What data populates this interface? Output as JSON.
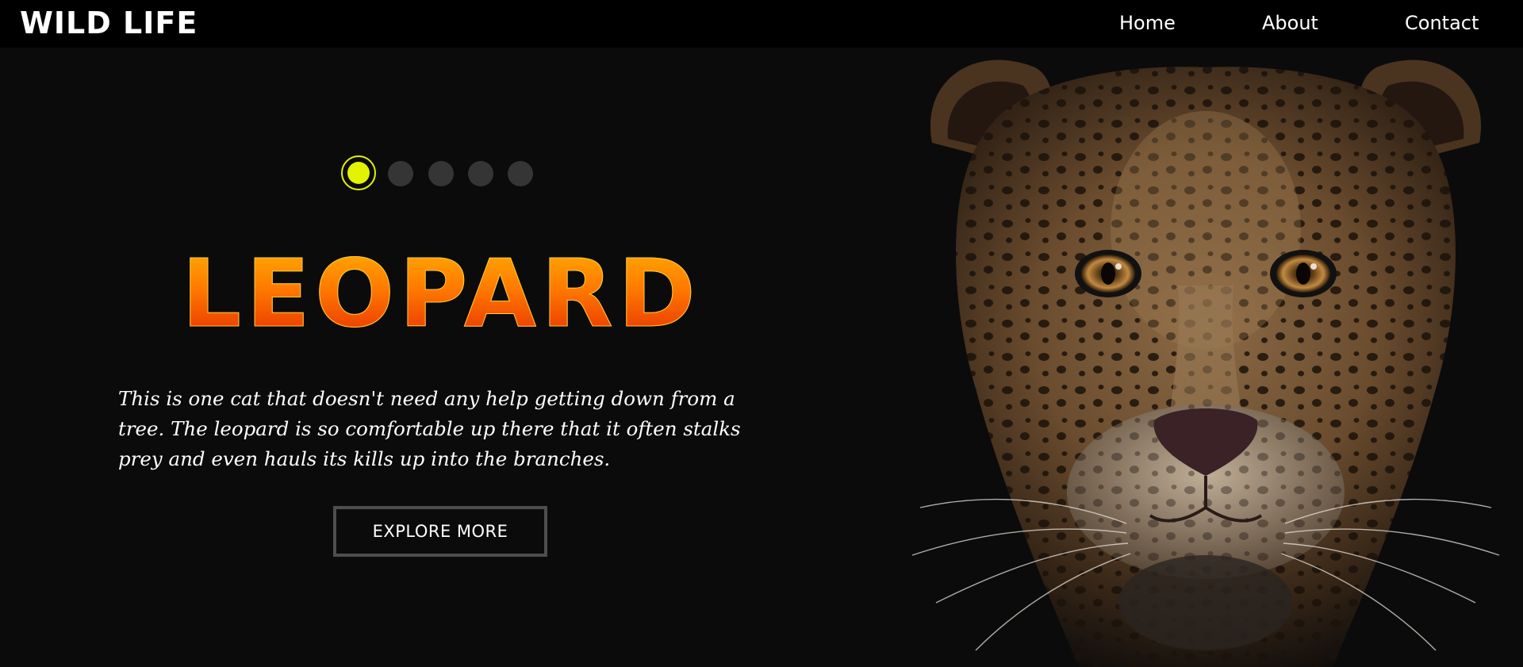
{
  "header": {
    "logo": "WILD LIFE",
    "nav": [
      {
        "label": "Home"
      },
      {
        "label": "About"
      },
      {
        "label": "Contact"
      }
    ]
  },
  "slider": {
    "dot_count": 5,
    "active_index": 0,
    "active_color": "#e2f300",
    "inactive_color": "#353535"
  },
  "hero": {
    "title": "LEOPARD",
    "description": "This is one cat that doesn't need any help getting down from a tree. The leopard is so comfortable up there that it often stalks prey and even hauls its kills up into the branches.",
    "button_label": "EXPLORE MORE",
    "title_gradient": [
      "#ffb100",
      "#ff7a00",
      "#e62a00"
    ],
    "image_subject": "leopard-face-image"
  },
  "colors": {
    "background": "#0b0b0b",
    "navbar": "#000000",
    "button_border": "#4e4e4e"
  }
}
